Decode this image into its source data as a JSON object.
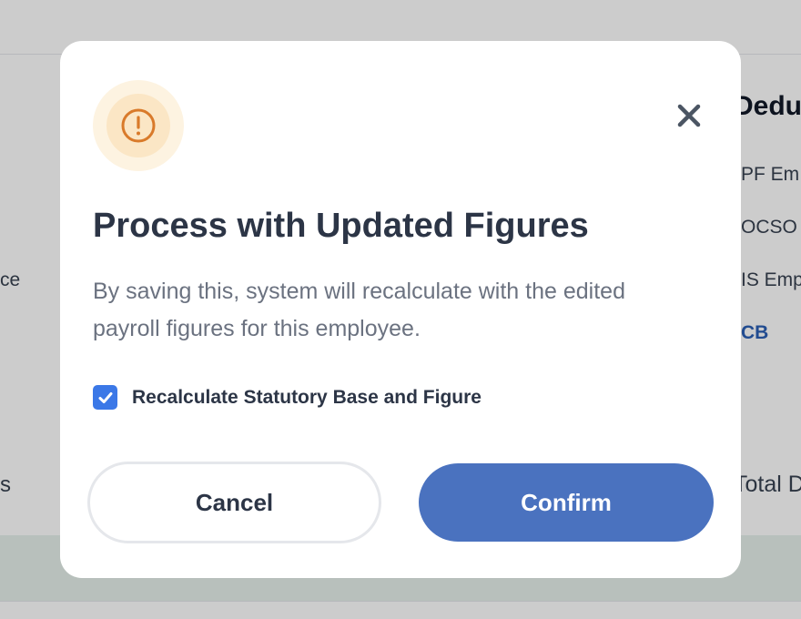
{
  "background": {
    "right_heading": "Dedu",
    "right_items": [
      "PF Em",
      "OCSO",
      "IS Emp"
    ],
    "right_link": "CB",
    "right_total": "Total D",
    "left_fragments": [
      "ce",
      "s"
    ]
  },
  "modal": {
    "icon": "exclamation-circle-icon",
    "close_icon": "close-icon",
    "title": "Process with Updated Figures",
    "description": "By saving this, system will recalculate with the edited payroll figures for this employee.",
    "checkbox": {
      "label": "Recalculate Statutory Base and Figure",
      "checked": true
    },
    "cancel_label": "Cancel",
    "confirm_label": "Confirm"
  },
  "colors": {
    "accent": "#4a72bf",
    "checkbox": "#3b78e7",
    "warning": "#d97a2a"
  }
}
